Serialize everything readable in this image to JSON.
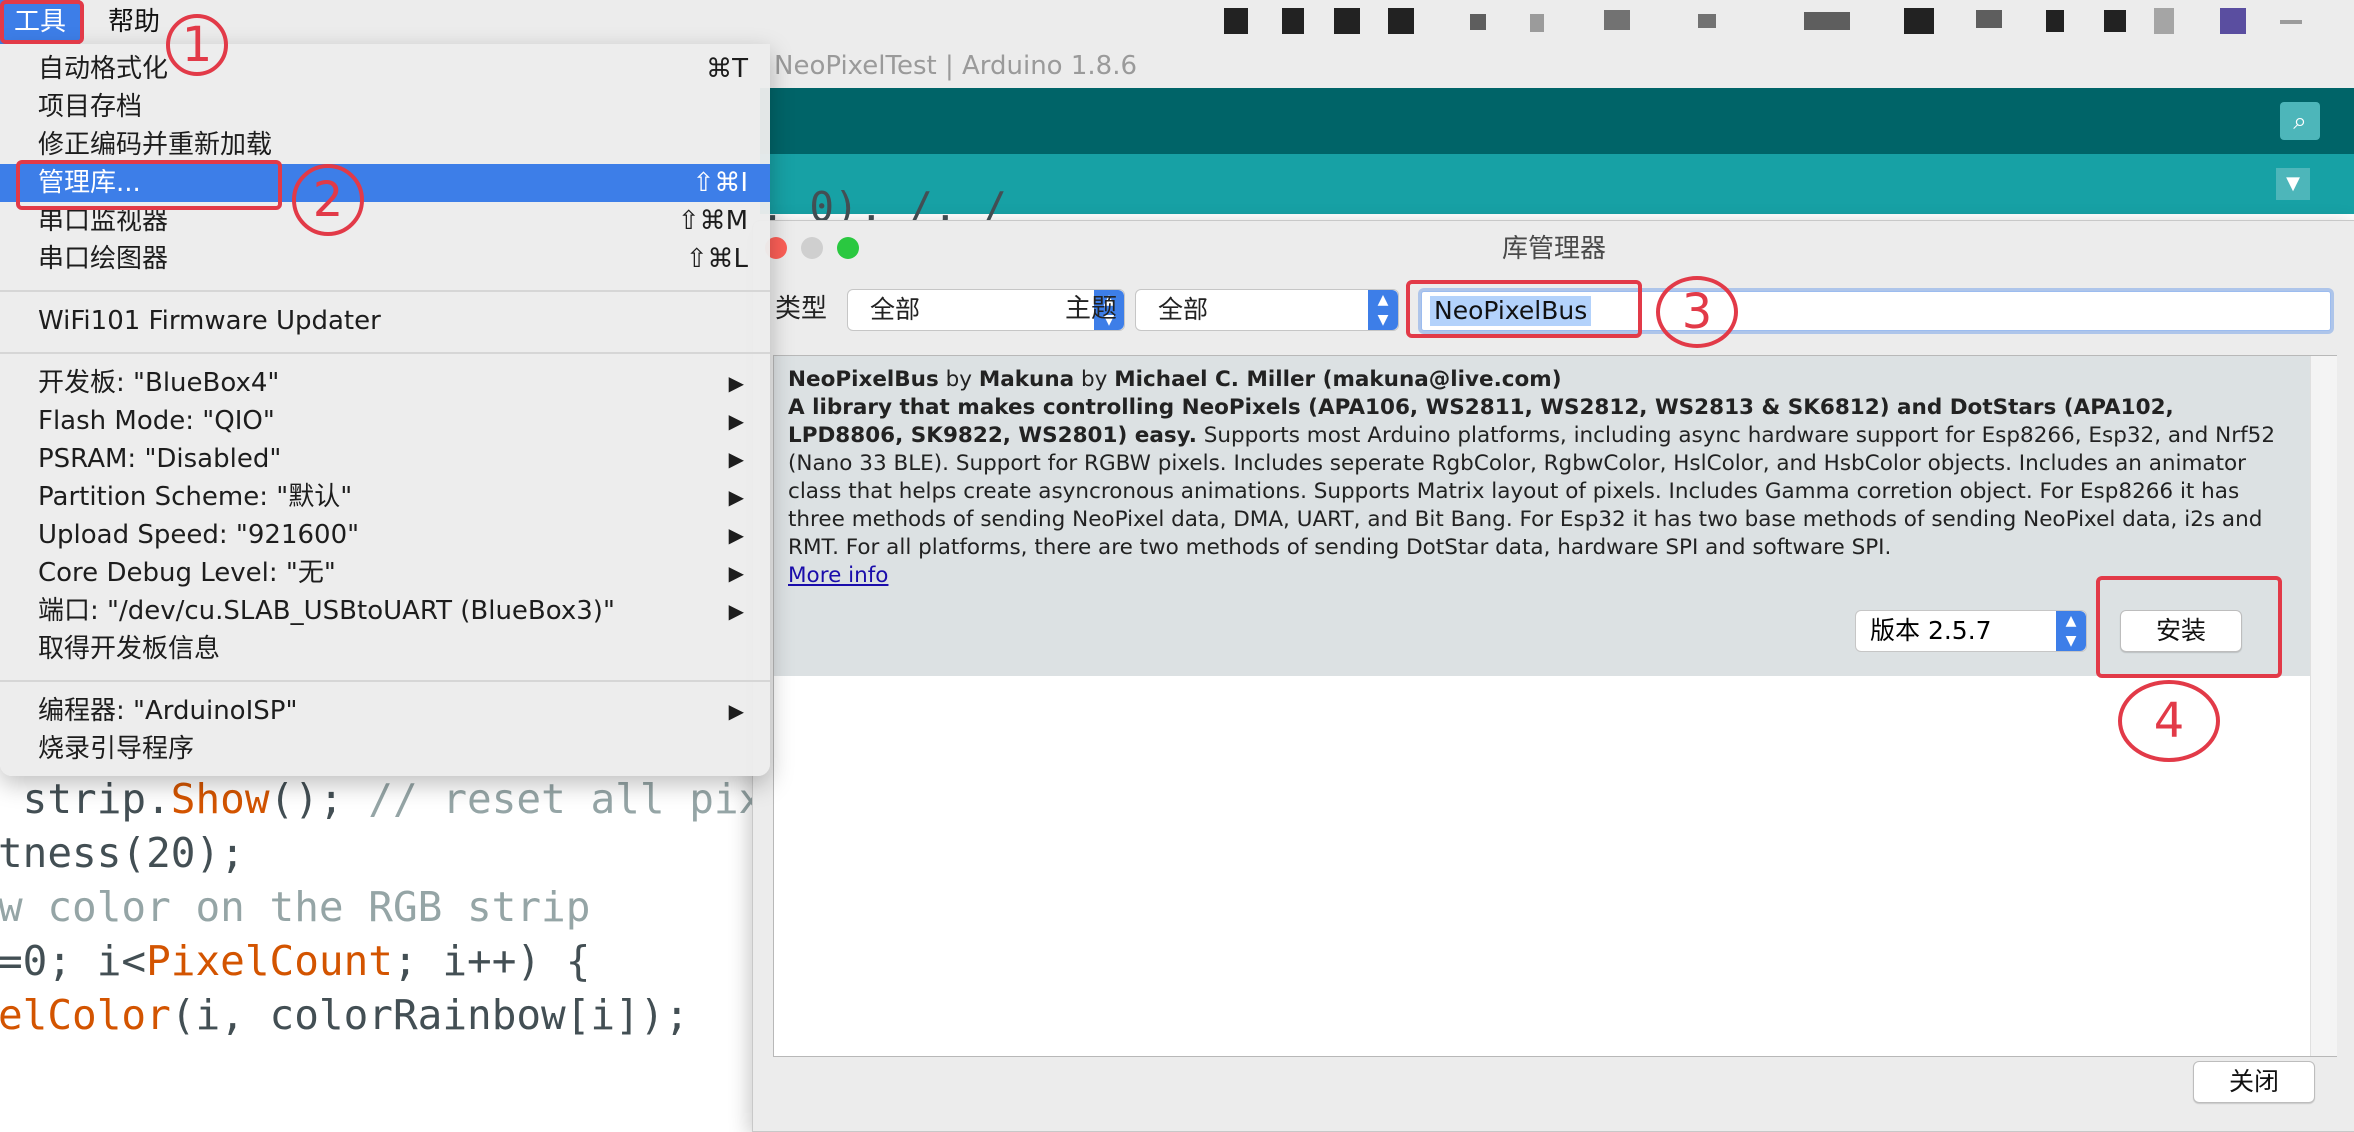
{
  "menubar": {
    "tools": "工具",
    "help": "帮助"
  },
  "arduino_window": {
    "title": "NeoPixelTest | Arduino 1.8.6",
    "code_lines": [
      {
        "a": " strip.",
        "b": "Show",
        "c": "(); ",
        "d": "// reset all pixe"
      },
      {
        "a": "tness(20);",
        "b": "",
        "c": "",
        "d": ""
      },
      {
        "a": "",
        "b": "",
        "c": "",
        "d": "w color on the RGB strip"
      },
      {
        "a": "=0; i<",
        "b": "PixelCount",
        "c": "; i++) {",
        "d": ""
      },
      {
        "a": "",
        "b": "elColor",
        "c": "(i, colorRainbow[i]);",
        "d": ""
      }
    ]
  },
  "tools_menu": {
    "items": [
      {
        "label": "自动格式化",
        "shortcut": "⌘T"
      },
      {
        "label": "项目存档",
        "shortcut": ""
      },
      {
        "label": "修正编码并重新加载",
        "shortcut": ""
      },
      {
        "label": "管理库...",
        "shortcut": "⇧⌘I"
      },
      {
        "label": "串口监视器",
        "shortcut": "⇧⌘M"
      },
      {
        "label": "串口绘图器",
        "shortcut": "⇧⌘L"
      },
      {
        "label": "WiFi101 Firmware Updater",
        "shortcut": ""
      },
      {
        "label": "开发板: \"BlueBox4\"",
        "shortcut": ""
      },
      {
        "label": "Flash Mode: \"QIO\"",
        "shortcut": ""
      },
      {
        "label": "PSRAM: \"Disabled\"",
        "shortcut": ""
      },
      {
        "label": "Partition Scheme: \"默认\"",
        "shortcut": ""
      },
      {
        "label": "Upload Speed: \"921600\"",
        "shortcut": ""
      },
      {
        "label": "Core Debug Level: \"无\"",
        "shortcut": ""
      },
      {
        "label": "端口: \"/dev/cu.SLAB_USBtoUART (BlueBox3)\"",
        "shortcut": ""
      },
      {
        "label": "取得开发板信息",
        "shortcut": ""
      },
      {
        "label": "编程器: \"ArduinoISP\"",
        "shortcut": ""
      },
      {
        "label": "烧录引导程序",
        "shortcut": ""
      }
    ],
    "submenu_arrow": "▶"
  },
  "library_manager": {
    "title": "库管理器",
    "type_label": "类型",
    "type_value": "全部",
    "topic_label": "主题",
    "topic_value": "全部",
    "search_value": "NeoPixelBus",
    "entry": {
      "name": "NeoPixelBus",
      "by1": "by",
      "author": "Makuna",
      "by2": "by",
      "maintainer": "Michael C. Miller (makuna@live.com)",
      "summary": "A library that makes controlling NeoPixels (APA106, WS2811, WS2812, WS2813 & SK6812) and DotStars (APA102, LPD8806, SK9822, WS2801) easy.",
      "description": "Supports most Arduino platforms, including async hardware support for Esp8266, Esp32, and Nrf52 (Nano 33 BLE). Support for RGBW pixels. Includes seperate RgbColor, RgbwColor, HslColor, and HsbColor objects. Includes an animator class that helps create asyncronous animations. Supports Matrix layout of pixels. Includes Gamma corretion object. For Esp8266 it has three methods of sending NeoPixel data, DMA, UART, and Bit Bang. For Esp32 it has two base methods of sending NeoPixel data, i2s and RMT. For all platforms, there are two methods of sending DotStar data, hardware SPI and software SPI.",
      "more_info": "More info",
      "version": "版本 2.5.7",
      "install": "安装"
    },
    "close": "关闭"
  },
  "annotations": [
    "1",
    "2",
    "3",
    "4"
  ],
  "colors": {
    "menu_highlight": "#3d7ee8",
    "arduino_teal_dark": "#006468",
    "arduino_teal": "#17a1a5",
    "annotation_red": "#e23a48"
  }
}
